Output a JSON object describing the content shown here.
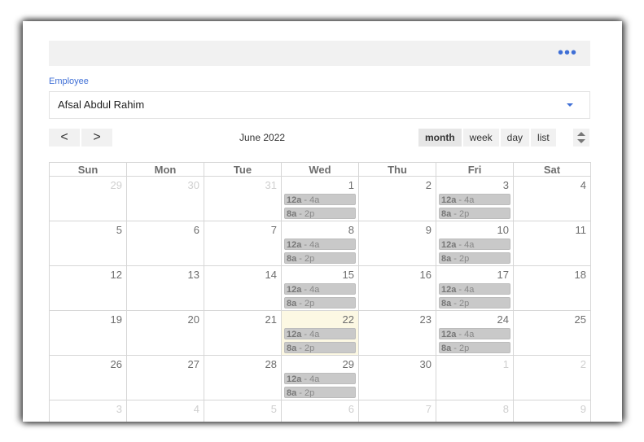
{
  "header": {
    "more_label": "•••"
  },
  "employee": {
    "label": "Employee",
    "value": "Afsal Abdul Rahim"
  },
  "toolbar": {
    "prev": "<",
    "next": ">",
    "title": "June 2022",
    "views": [
      {
        "label": "month",
        "active": true
      },
      {
        "label": "week",
        "active": false
      },
      {
        "label": "day",
        "active": false
      },
      {
        "label": "list",
        "active": false
      }
    ]
  },
  "calendar": {
    "weekdays": [
      "Sun",
      "Mon",
      "Tue",
      "Wed",
      "Thu",
      "Fri",
      "Sat"
    ],
    "weeks": [
      [
        {
          "day": "29",
          "other": true,
          "events": []
        },
        {
          "day": "30",
          "other": true,
          "events": []
        },
        {
          "day": "31",
          "other": true,
          "events": []
        },
        {
          "day": "1",
          "events": [
            {
              "time": "12a",
              "rest": " - 4a"
            },
            {
              "time": "8a",
              "rest": " - 2p"
            }
          ]
        },
        {
          "day": "2",
          "events": []
        },
        {
          "day": "3",
          "events": [
            {
              "time": "12a",
              "rest": " - 4a"
            },
            {
              "time": "8a",
              "rest": " - 2p"
            }
          ]
        },
        {
          "day": "4",
          "events": []
        }
      ],
      [
        {
          "day": "5",
          "events": []
        },
        {
          "day": "6",
          "events": []
        },
        {
          "day": "7",
          "events": []
        },
        {
          "day": "8",
          "events": [
            {
              "time": "12a",
              "rest": " - 4a"
            },
            {
              "time": "8a",
              "rest": " - 2p"
            }
          ]
        },
        {
          "day": "9",
          "events": []
        },
        {
          "day": "10",
          "events": [
            {
              "time": "12a",
              "rest": " - 4a"
            },
            {
              "time": "8a",
              "rest": " - 2p"
            }
          ]
        },
        {
          "day": "11",
          "events": []
        }
      ],
      [
        {
          "day": "12",
          "events": []
        },
        {
          "day": "13",
          "events": []
        },
        {
          "day": "14",
          "events": []
        },
        {
          "day": "15",
          "events": [
            {
              "time": "12a",
              "rest": " - 4a"
            },
            {
              "time": "8a",
              "rest": " - 2p"
            }
          ]
        },
        {
          "day": "16",
          "events": []
        },
        {
          "day": "17",
          "events": [
            {
              "time": "12a",
              "rest": " - 4a"
            },
            {
              "time": "8a",
              "rest": " - 2p"
            }
          ]
        },
        {
          "day": "18",
          "events": []
        }
      ],
      [
        {
          "day": "19",
          "events": []
        },
        {
          "day": "20",
          "events": []
        },
        {
          "day": "21",
          "events": []
        },
        {
          "day": "22",
          "today": true,
          "events": [
            {
              "time": "12a",
              "rest": " - 4a"
            },
            {
              "time": "8a",
              "rest": " - 2p"
            }
          ]
        },
        {
          "day": "23",
          "events": []
        },
        {
          "day": "24",
          "events": [
            {
              "time": "12a",
              "rest": " - 4a"
            },
            {
              "time": "8a",
              "rest": " - 2p"
            }
          ]
        },
        {
          "day": "25",
          "events": []
        }
      ],
      [
        {
          "day": "26",
          "events": []
        },
        {
          "day": "27",
          "events": []
        },
        {
          "day": "28",
          "events": []
        },
        {
          "day": "29",
          "events": [
            {
              "time": "12a",
              "rest": " - 4a"
            },
            {
              "time": "8a",
              "rest": " - 2p"
            }
          ]
        },
        {
          "day": "30",
          "events": []
        },
        {
          "day": "1",
          "other": true,
          "events": []
        },
        {
          "day": "2",
          "other": true,
          "events": []
        }
      ],
      [
        {
          "day": "3",
          "other": true,
          "events": []
        },
        {
          "day": "4",
          "other": true,
          "events": []
        },
        {
          "day": "5",
          "other": true,
          "events": []
        },
        {
          "day": "6",
          "other": true,
          "events": []
        },
        {
          "day": "7",
          "other": true,
          "events": []
        },
        {
          "day": "8",
          "other": true,
          "events": []
        },
        {
          "day": "9",
          "other": true,
          "events": []
        }
      ]
    ]
  },
  "colors": {
    "accent": "#3f6fd6",
    "today_bg": "#fcf8e3",
    "event_bg": "#c9c9c9",
    "toolbar_bg": "#f1f1f1"
  }
}
